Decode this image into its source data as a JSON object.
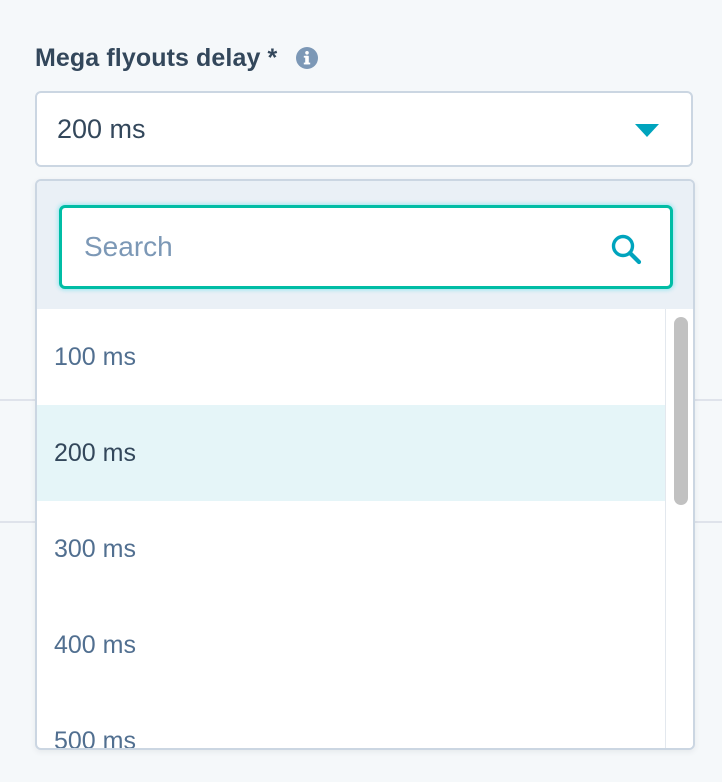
{
  "field": {
    "label": "Mega flyouts delay *",
    "info_icon": "info-icon",
    "selected_value": "200 ms",
    "caret_icon": "caret-down-icon"
  },
  "dropdown": {
    "search": {
      "placeholder": "Search",
      "value": "",
      "icon": "search-icon"
    },
    "options": [
      {
        "label": "100 ms",
        "selected": false
      },
      {
        "label": "200 ms",
        "selected": true
      },
      {
        "label": "300 ms",
        "selected": false
      },
      {
        "label": "400 ms",
        "selected": false
      },
      {
        "label": "500 ms",
        "selected": false
      }
    ]
  },
  "colors": {
    "label_text": "#33475b",
    "option_text": "#516f90",
    "accent_teal": "#00a4bd",
    "search_border": "#00bda5",
    "selected_option_bg": "#e5f5f8",
    "search_area_bg": "#eaf0f6",
    "info_icon": "#7c98b6"
  }
}
